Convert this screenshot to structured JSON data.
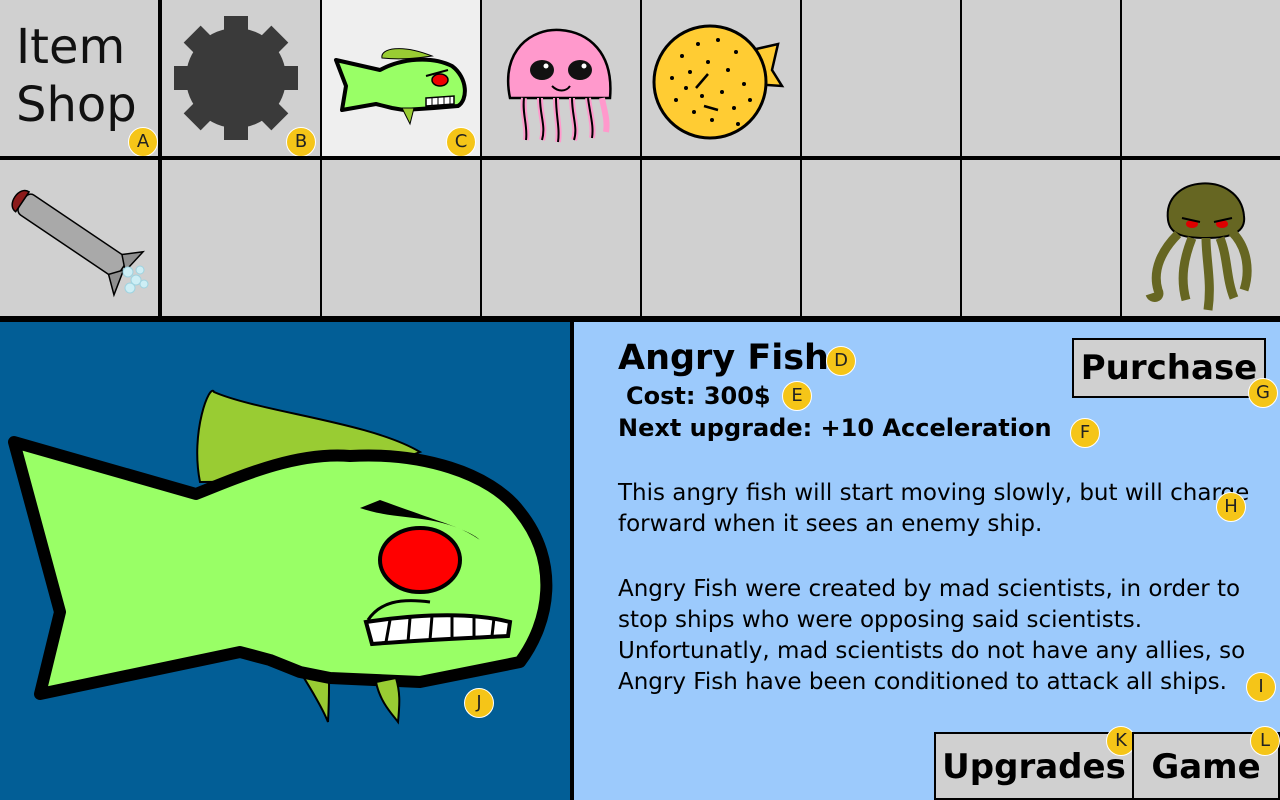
{
  "shop": {
    "title_line1": "Item",
    "title_line2": "Shop"
  },
  "items": {
    "row1": [
      "mine-icon",
      "angry-fish-icon",
      "jellyfish-icon",
      "pufferfish-icon",
      "",
      "",
      ""
    ],
    "row2": [
      "torpedo-icon",
      "",
      "",
      "",
      "",
      "",
      "",
      "kraken-icon"
    ]
  },
  "detail": {
    "name": "Angry Fish",
    "cost": "Cost: 300$",
    "next_upgrade": "Next upgrade: +10 Acceleration",
    "description_1": "This angry fish will start moving slowly, but will charge forward when it sees an enemy ship.",
    "description_2": "Angry Fish were created by mad scientists, in order to stop ships who were opposing said scientists. Unfortunatly, mad scientists do not have any allies, so Angry Fish have been conditioned to attack all ships."
  },
  "buttons": {
    "purchase": "Purchase",
    "upgrades": "Upgrades",
    "game": "Game"
  },
  "badges": {
    "a": "A",
    "b": "B",
    "c": "C",
    "d": "D",
    "e": "E",
    "f": "F",
    "g": "G",
    "h": "H",
    "i": "I",
    "j": "J",
    "k": "K",
    "l": "L"
  },
  "colors": {
    "cell_bg": "#d0d0d0",
    "selected_cell_bg": "#efefef",
    "preview_bg": "#025e96",
    "info_bg": "#9ccafc",
    "badge": "#f5c518",
    "fish_body": "#99ff66",
    "fish_fin": "#99cc33",
    "fish_eye": "#ff0000"
  }
}
